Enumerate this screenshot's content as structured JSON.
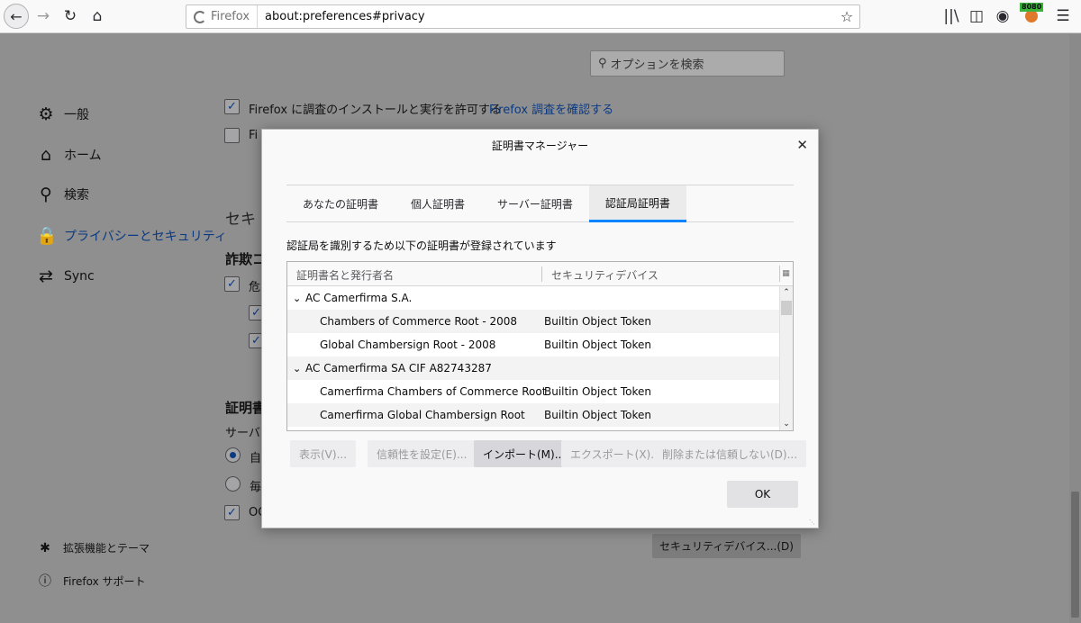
{
  "browser": {
    "identity_label": "Firefox",
    "url": "about:preferences#privacy",
    "badge_count": "8080",
    "icons": {
      "back": "arrow-left-icon",
      "forward": "arrow-right-icon",
      "reload": "reload-icon",
      "home": "home-icon",
      "bookmark": "star-icon",
      "library": "library-icon",
      "sidebar": "sidebar-icon",
      "account": "account-icon",
      "extension": "extension-badge-icon",
      "menu": "hamburger-menu-icon"
    }
  },
  "prefs": {
    "search_placeholder": "オプションを検索",
    "nav": [
      {
        "label": "一般",
        "icon": "gear-icon"
      },
      {
        "label": "ホーム",
        "icon": "home-icon"
      },
      {
        "label": "検索",
        "icon": "search-icon"
      },
      {
        "label": "プライバシーとセキュリティ",
        "icon": "lock-icon"
      },
      {
        "label": "Sync",
        "icon": "sync-icon"
      }
    ],
    "nav_bottom": [
      {
        "label": "拡張機能とテーマ",
        "icon": "puzzle-icon"
      },
      {
        "label": "Firefox サポート",
        "icon": "help-icon"
      }
    ],
    "studies_label": "Firefox に調査のインストールと実行を許可する",
    "studies_link": "Firefox 調査を確認する",
    "partial_fi": "Fi",
    "partial_sec_heading": "セキ",
    "partial_fraud_heading": "詐欺コ",
    "partial_danger": "危",
    "partial_cert_heading": "証明書",
    "partial_server": "サーバー",
    "partial_auto": "自",
    "partial_every": "毎",
    "partial_oc": "OC",
    "security_devices_button": "セキュリティデバイス...(D)"
  },
  "dialog": {
    "title": "証明書マネージャー",
    "tabs": [
      "あなたの証明書",
      "個人証明書",
      "サーバー証明書",
      "認証局証明書"
    ],
    "selected_tab": 3,
    "description": "認証局を識別するため以下の証明書が登録されています",
    "columns": [
      "証明書名と発行者名",
      "セキュリティデバイス"
    ],
    "rows": [
      {
        "name": "AC Camerfirma S.A.",
        "device": "",
        "group": true
      },
      {
        "name": "Chambers of Commerce Root - 2008",
        "device": "Builtin Object Token",
        "group": false
      },
      {
        "name": "Global Chambersign Root - 2008",
        "device": "Builtin Object Token",
        "group": false
      },
      {
        "name": "AC Camerfirma SA CIF A82743287",
        "device": "",
        "group": true
      },
      {
        "name": "Camerfirma Chambers of Commerce Root",
        "device": "Builtin Object Token",
        "group": false
      },
      {
        "name": "Camerfirma Global Chambersign Root",
        "device": "Builtin Object Token",
        "group": false
      }
    ],
    "buttons": {
      "view": "表示(V)...",
      "trust": "信頼性を設定(E)...",
      "import": "インポート(M)...",
      "export": "エクスポート(X)...",
      "delete": "削除または信頼しない(D)..."
    },
    "ok": "OK"
  }
}
